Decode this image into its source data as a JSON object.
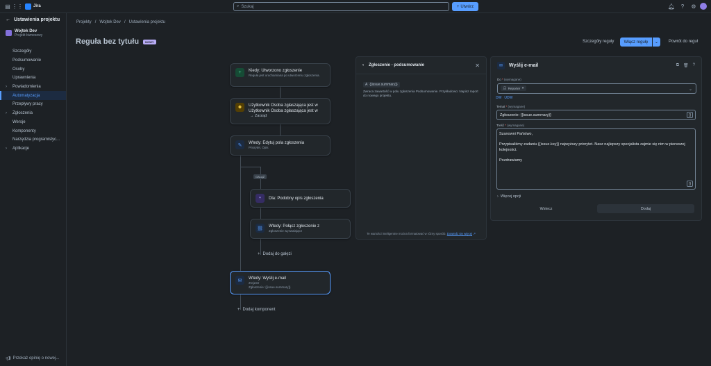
{
  "topbar": {
    "app_name": "Jira",
    "search_placeholder": "Szukaj",
    "create_label": "Utwórz"
  },
  "sidebar": {
    "back_label": "Ustawienia projektu",
    "project_name": "Wojtek Dev",
    "project_type": "Projekt biznesowy",
    "items": [
      {
        "label": "Szczegóły",
        "chevron": false,
        "active": false
      },
      {
        "label": "Podsumowanie",
        "chevron": false,
        "active": false
      },
      {
        "label": "Osoby",
        "chevron": false,
        "active": false
      },
      {
        "label": "Uprawnienia",
        "chevron": false,
        "active": false
      },
      {
        "label": "Powiadomienia",
        "chevron": true,
        "active": false
      },
      {
        "label": "Automatyzacja",
        "chevron": false,
        "active": true
      },
      {
        "label": "Przepływy pracy",
        "chevron": false,
        "active": false
      },
      {
        "label": "Zgłoszenia",
        "chevron": true,
        "active": false
      },
      {
        "label": "Wersje",
        "chevron": false,
        "active": false
      },
      {
        "label": "Komponenty",
        "chevron": false,
        "active": false
      },
      {
        "label": "Narzędzia programistyc...",
        "chevron": false,
        "active": false
      },
      {
        "label": "Aplikacje",
        "chevron": true,
        "active": false
      }
    ],
    "feedback_label": "Przekaż opinię o nowej..."
  },
  "breadcrumb": [
    "Projekty",
    "/",
    "Wojtek Dev",
    "/",
    "Ustawienia projektu"
  ],
  "header": {
    "title": "Reguła bez tytułu",
    "badge": "NOWY",
    "rule_details": "Szczegóły reguły",
    "enable_rule": "Włącz regułę",
    "back_to_rules": "Powrót do reguł"
  },
  "flow": {
    "trigger": {
      "title": "Kiedy: Utworzono zgłoszenie",
      "sub": "Reguła jest uruchamiana po utworzeniu zgłoszenia."
    },
    "condition": {
      "title1": "Użytkownik Osoba zgłaszająca jest w",
      "title2": "Użytkownik Osoba zgłaszająca jest w",
      "sub": "→ Zarząd"
    },
    "edit": {
      "title": "Wtedy: Edytuj pola zgłoszenia",
      "sub": "Priorytet, Opis"
    },
    "branch_tag": "GAŁĄŹ",
    "for": {
      "title": "Dla: Podobny opis zgłoszenia"
    },
    "link": {
      "title": "Wtedy: Połącz zgłoszenie z",
      "sub": "Zgłoszenie wyzwalające"
    },
    "add_branch": "Dodaj do gałęzi",
    "email": {
      "title": "Wtedy: Wyślij e-mail",
      "sub1": "Zrejestr",
      "sub2": "Zgłoszenie: {{issue.summary}}"
    },
    "add_component": "Dodaj komponent"
  },
  "smart_panel": {
    "title": "Zgłoszenie - podsumowanie",
    "tag": "{{issue.summary}}",
    "description": "Zwraca zawartość w polu zgłoszenia Podsumowanie. Przykładowo: Napisz raport do nowego projektu.",
    "footer": "Te wartości inteligentne można formatować w różny sposób.",
    "footer_link": "Dowiedz się więcej"
  },
  "email_panel": {
    "title": "Wyślij e-mail",
    "to_label": "Do",
    "required": "(wymagane)",
    "to_chip": "Reporter",
    "cc_bcc": [
      "DW",
      "UDW"
    ],
    "subject_label": "Temat",
    "subject_value": "Zgłoszenie: {{issue.summary}}",
    "body_label": "Treść",
    "body_lines": [
      "Szanowni Państwo,",
      "",
      "Przypisaliśmy zadaniu {{issue.key}} najwyższy priorytet. Nasz najlepszy specjalista zajmie się nim w pierwszej kolejności.",
      "",
      "Pozdrawiamy"
    ],
    "more_options": "Więcej opcji",
    "back": "Wstecz",
    "add": "Dodaj"
  }
}
